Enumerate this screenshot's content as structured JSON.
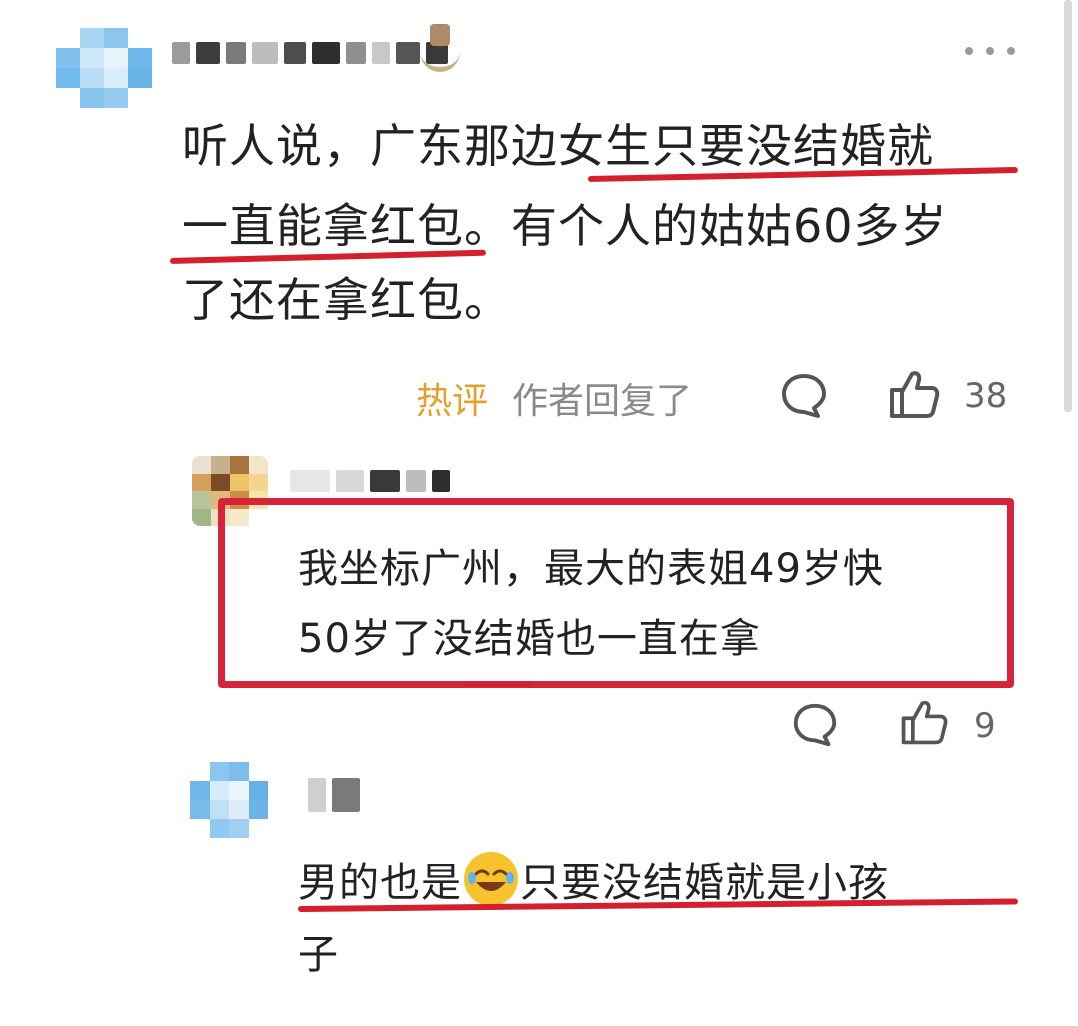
{
  "comment1": {
    "text_line1": "听人说，广东那边女生只要没结婚就",
    "text_line2": "一直能拿红包。有个人的姑姑60多岁",
    "text_line3": "了还在拿红包。",
    "hot_label": "热评",
    "author_replied_label": "作者回复了",
    "like_count": "38",
    "more_icon": "more-dots-icon",
    "comment_icon": "comment-bubble-icon",
    "like_icon": "thumbs-up-icon"
  },
  "reply1": {
    "text_line1": "我坐标广州，最大的表姐49岁快",
    "text_line2": "50岁了没结婚也一直在拿",
    "like_count": "9"
  },
  "reply2": {
    "text_part1": "男的也是",
    "emoji": "rolling-laughing-emoji",
    "text_part2": "只要没结婚就是小孩",
    "text_line2": "子"
  },
  "colors": {
    "accent_red": "#d4202c",
    "hot_label": "#e2a12a",
    "meta_gray": "#8a8a8a"
  }
}
